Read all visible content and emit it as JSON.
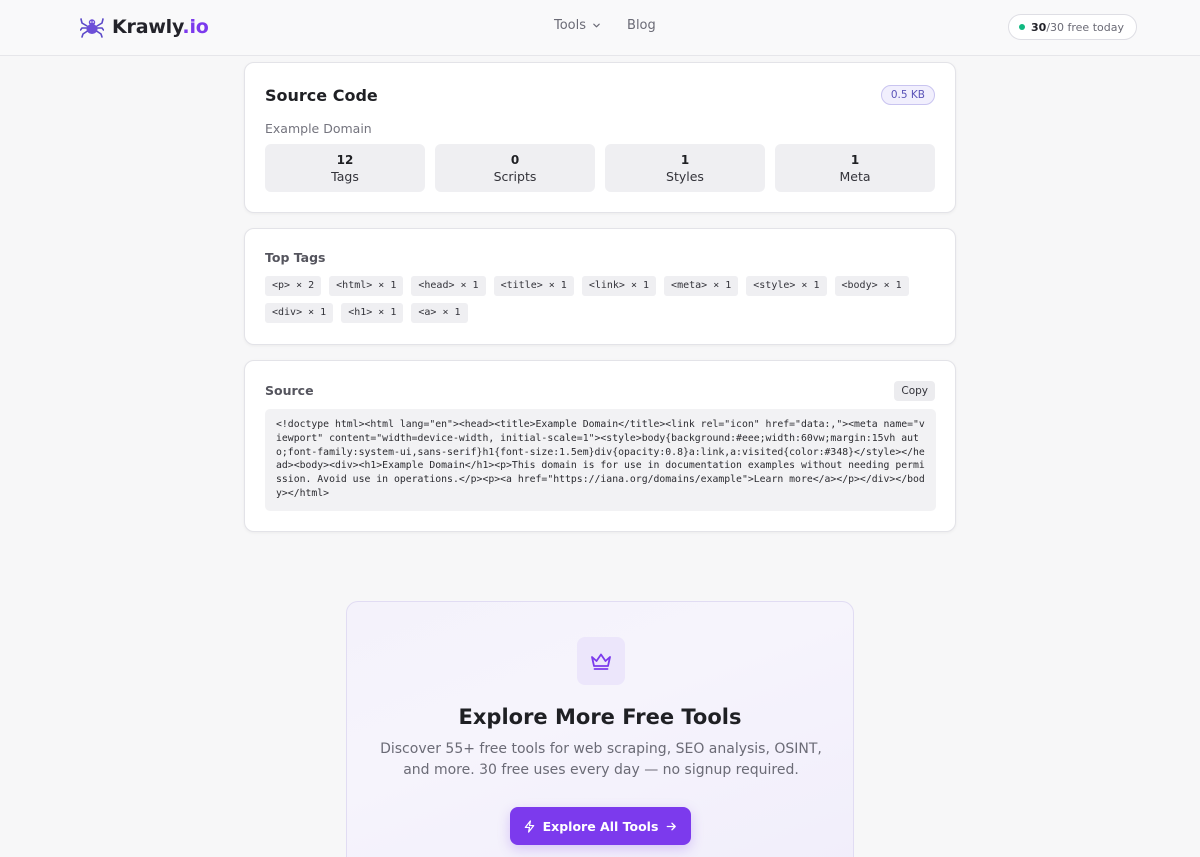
{
  "header": {
    "logo_name": "Krawly",
    "logo_tld": ".io",
    "nav": {
      "tools": "Tools",
      "blog": "Blog"
    },
    "usage": {
      "count": "30",
      "rest": "/30 free today"
    }
  },
  "summary_card": {
    "title": "Source Code",
    "size": "0.5 KB",
    "page_title": "Example Domain",
    "stats": [
      {
        "value": "12",
        "label": "Tags"
      },
      {
        "value": "0",
        "label": "Scripts"
      },
      {
        "value": "1",
        "label": "Styles"
      },
      {
        "value": "1",
        "label": "Meta"
      }
    ]
  },
  "top_tags": {
    "title": "Top Tags",
    "tags": [
      "<p> × 2",
      "<html> × 1",
      "<head> × 1",
      "<title> × 1",
      "<link> × 1",
      "<meta> × 1",
      "<style> × 1",
      "<body> × 1",
      "<div> × 1",
      "<h1> × 1",
      "<a> × 1"
    ]
  },
  "source": {
    "title": "Source",
    "copy_label": "Copy",
    "code": "<!doctype html><html lang=\"en\"><head><title>Example Domain</title><link rel=\"icon\" href=\"data:,\"><meta name=\"viewport\" content=\"width=device-width, initial-scale=1\"><style>body{background:#eee;width:60vw;margin:15vh auto;font-family:system-ui,sans-serif}h1{font-size:1.5em}div{opacity:0.8}a:link,a:visited{color:#348}</style></head><body><div><h1>Example Domain</h1><p>This domain is for use in documentation examples without needing permission. Avoid use in operations.</p><p><a href=\"https://iana.org/domains/example\">Learn more</a></p></div></body></html>"
  },
  "cta": {
    "title": "Explore More Free Tools",
    "description": "Discover 55+ free tools for web scraping, SEO analysis, OSINT, and more. 30 free uses every day — no signup required.",
    "button_label": "Explore All Tools"
  },
  "colors": {
    "accent": "#7c3aed",
    "status_dot": "#10b981",
    "badge_text": "#5b54b8"
  },
  "icons": {
    "logo": "spider-icon",
    "nav_dropdown": "chevron-down-icon",
    "cta": "crown-icon",
    "button_leading": "lightning-icon",
    "button_trailing": "arrow-right-icon"
  }
}
